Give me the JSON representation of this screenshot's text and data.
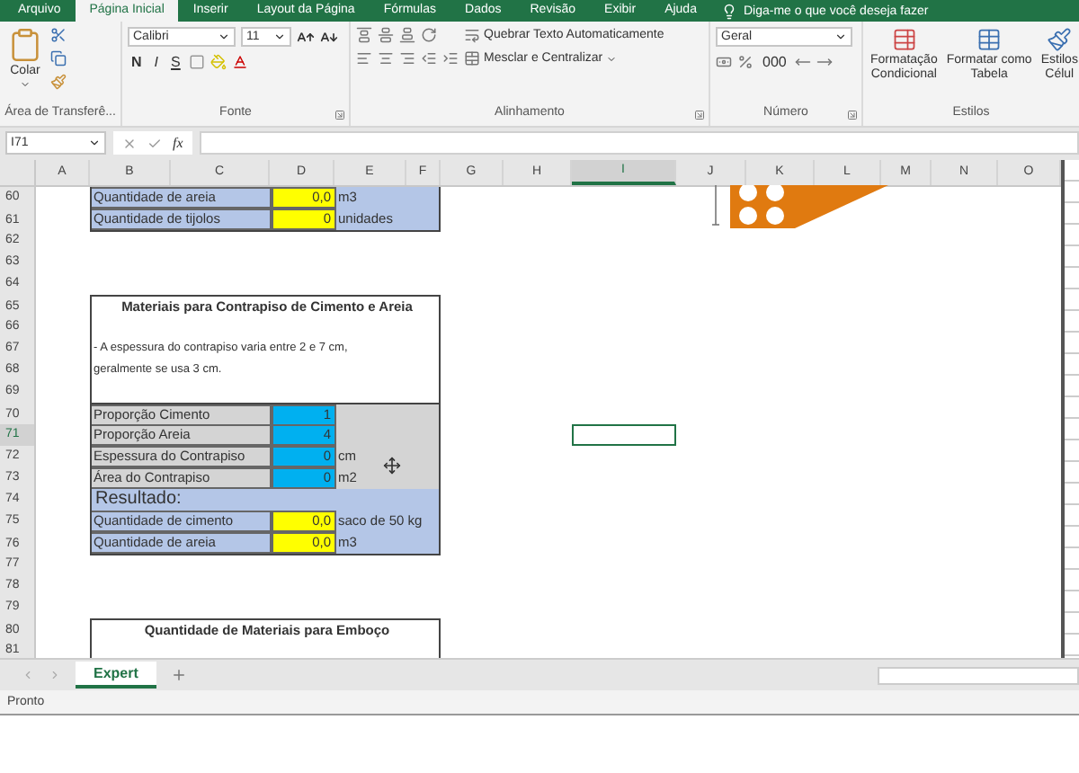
{
  "ribbon": {
    "tabs": [
      {
        "label": "Arquivo",
        "selected": false
      },
      {
        "label": "Página Inicial",
        "selected": true
      },
      {
        "label": "Inserir",
        "selected": false
      },
      {
        "label": "Layout da Página",
        "selected": false
      },
      {
        "label": "Fórmulas",
        "selected": false
      },
      {
        "label": "Dados",
        "selected": false
      },
      {
        "label": "Revisão",
        "selected": false
      },
      {
        "label": "Exibir",
        "selected": false
      },
      {
        "label": "Ajuda",
        "selected": false
      }
    ],
    "tell_me": "Diga-me o que você deseja fazer",
    "clipboard": {
      "label": "Área de Transferê...",
      "paste": "Colar"
    },
    "font": {
      "label": "Fonte",
      "font": "Calibri",
      "size": "11",
      "bold": "N",
      "italic": "I",
      "underline": "S"
    },
    "alignment": {
      "label": "Alinhamento",
      "wrap": "Quebrar Texto Automaticamente",
      "merge": "Mesclar e Centralizar"
    },
    "number": {
      "label": "Número",
      "format": "Geral",
      "thousands": "000"
    },
    "styles": {
      "label": "Estilos",
      "conditional": [
        "Formatação",
        "Condicional"
      ],
      "table": [
        "Formatar como",
        "Tabela"
      ],
      "cell": [
        "Estilos",
        "Célul"
      ]
    }
  },
  "formula_bar": {
    "name_box": "I71",
    "function_button": "fx"
  },
  "columns": [
    {
      "label": "A",
      "selected": false
    },
    {
      "label": "B",
      "selected": false
    },
    {
      "label": "C",
      "selected": false
    },
    {
      "label": "D",
      "selected": false
    },
    {
      "label": "E",
      "selected": false
    },
    {
      "label": "F",
      "selected": false
    },
    {
      "label": "G",
      "selected": false
    },
    {
      "label": "H",
      "selected": false
    },
    {
      "label": "I",
      "selected": true
    },
    {
      "label": "J",
      "selected": false
    },
    {
      "label": "K",
      "selected": false
    },
    {
      "label": "L",
      "selected": false
    },
    {
      "label": "M",
      "selected": false
    },
    {
      "label": "N",
      "selected": false
    },
    {
      "label": "O",
      "selected": false
    }
  ],
  "rows": [
    {
      "number": "60",
      "selected": false,
      "kind": "result",
      "label": "Quantidade de areia",
      "value": "0,0",
      "unit": "m3"
    },
    {
      "number": "61",
      "selected": false,
      "kind": "result",
      "label": "Quantidade de tijolos",
      "value": "0",
      "unit": "unidades"
    },
    {
      "number": "62",
      "selected": false,
      "kind": "blank"
    },
    {
      "number": "63",
      "selected": false,
      "kind": "blank"
    },
    {
      "number": "64",
      "selected": false,
      "kind": "blank"
    },
    {
      "number": "65",
      "selected": false,
      "kind": "title",
      "text": "Materiais para Contrapiso de Cimento e Areia"
    },
    {
      "number": "66",
      "selected": false,
      "kind": "box"
    },
    {
      "number": "67",
      "selected": false,
      "kind": "note",
      "text": "- A espessura do contrapiso varia entre 2 e 7 cm,"
    },
    {
      "number": "68",
      "selected": false,
      "kind": "note",
      "text": "geralmente se usa 3 cm."
    },
    {
      "number": "69",
      "selected": false,
      "kind": "box"
    },
    {
      "number": "70",
      "selected": false,
      "kind": "input",
      "label": "Proporção Cimento",
      "value": "1"
    },
    {
      "number": "71",
      "selected": true,
      "kind": "input",
      "label": "Proporção Areia",
      "value": "4"
    },
    {
      "number": "72",
      "selected": false,
      "kind": "input",
      "label": "Espessura do Contrapiso",
      "value": "0",
      "unit": "cm"
    },
    {
      "number": "73",
      "selected": false,
      "kind": "input",
      "label": "Área do Contrapiso",
      "value": "0",
      "unit": "m2"
    },
    {
      "number": "74",
      "selected": false,
      "kind": "heading",
      "text": "Resultado:"
    },
    {
      "number": "75",
      "selected": false,
      "kind": "result",
      "label": "Quantidade de cimento",
      "value": "0,0",
      "unit": "saco de 50 kg"
    },
    {
      "number": "76",
      "selected": false,
      "kind": "result",
      "label": "Quantidade de areia",
      "value": "0,0",
      "unit": "m3"
    },
    {
      "number": "77",
      "selected": false,
      "kind": "blank"
    },
    {
      "number": "78",
      "selected": false,
      "kind": "blank"
    },
    {
      "number": "79",
      "selected": false,
      "kind": "blank"
    },
    {
      "number": "80",
      "selected": false,
      "kind": "title",
      "text": "Quantidade de Materiais para Emboço"
    },
    {
      "number": "81",
      "selected": false,
      "kind": "box"
    }
  ],
  "sheet_tabs": [
    {
      "label": "Expert",
      "selected": true
    }
  ],
  "status_bar": {
    "text": "Pronto"
  }
}
